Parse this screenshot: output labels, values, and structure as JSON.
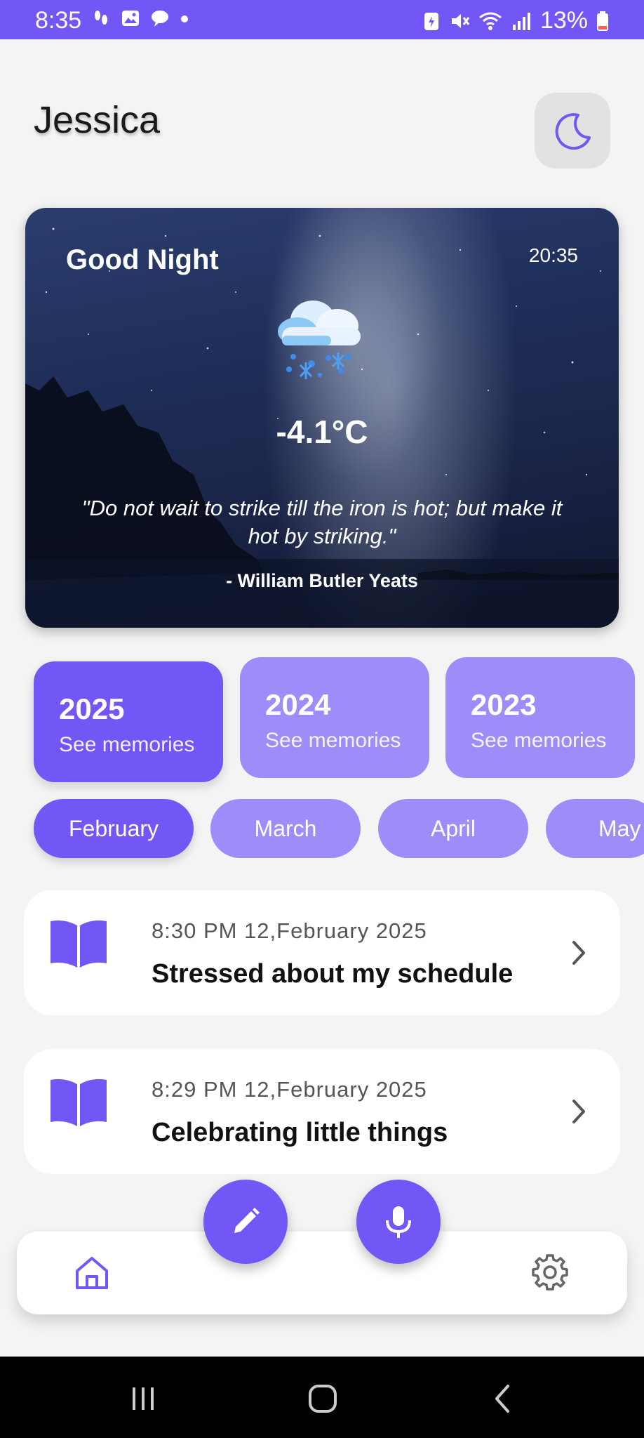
{
  "status_bar": {
    "time": "8:35",
    "battery": "13%"
  },
  "header": {
    "user_name": "Jessica",
    "theme_toggle_icon": "moon-icon"
  },
  "hero": {
    "greeting": "Good Night",
    "time": "20:35",
    "weather_icon": "snow-cloud-icon",
    "temperature": "-4.1°C",
    "quote": "\"Do not wait to strike till the iron is hot; but make it hot by striking.\"",
    "author": "- William Butler Yeats"
  },
  "years": [
    {
      "year": "2025",
      "label": "See memories",
      "active": true
    },
    {
      "year": "2024",
      "label": "See memories",
      "active": false
    },
    {
      "year": "2023",
      "label": "See memories",
      "active": false
    }
  ],
  "months": [
    {
      "label": "February",
      "active": true
    },
    {
      "label": "March",
      "active": false
    },
    {
      "label": "April",
      "active": false
    },
    {
      "label": "May",
      "active": false
    }
  ],
  "entries": [
    {
      "meta": "8:30 PM 12,February 2025",
      "title": "Stressed about my schedule"
    },
    {
      "meta": "8:29 PM 12,February 2025",
      "title": "Celebrating little things"
    }
  ],
  "actions": {
    "write_icon": "pencil-icon",
    "voice_icon": "microphone-icon"
  },
  "bottom_nav": {
    "home_icon": "home-icon",
    "settings_icon": "gear-icon"
  },
  "colors": {
    "accent": "#7357f6",
    "accent_light": "#9e8cf9",
    "background": "#f4f4f4"
  }
}
